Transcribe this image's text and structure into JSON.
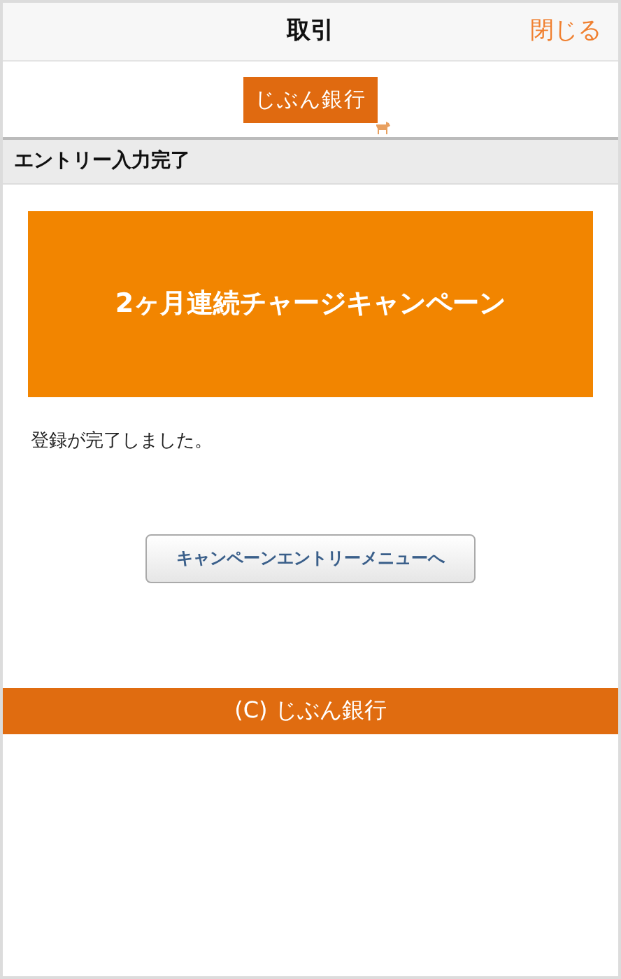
{
  "nav_bar": {
    "title": "取引",
    "close_link": "閉じる"
  },
  "logo": {
    "text": "じぶん銀行"
  },
  "section_header": "エントリー入力完了",
  "banner": {
    "text": "2ヶ月連続チャージキャンペーン"
  },
  "message": "登録が完了しました。",
  "button": "キャンペーンエントリーメニューへ",
  "footer": "(C) じぶん銀行"
}
